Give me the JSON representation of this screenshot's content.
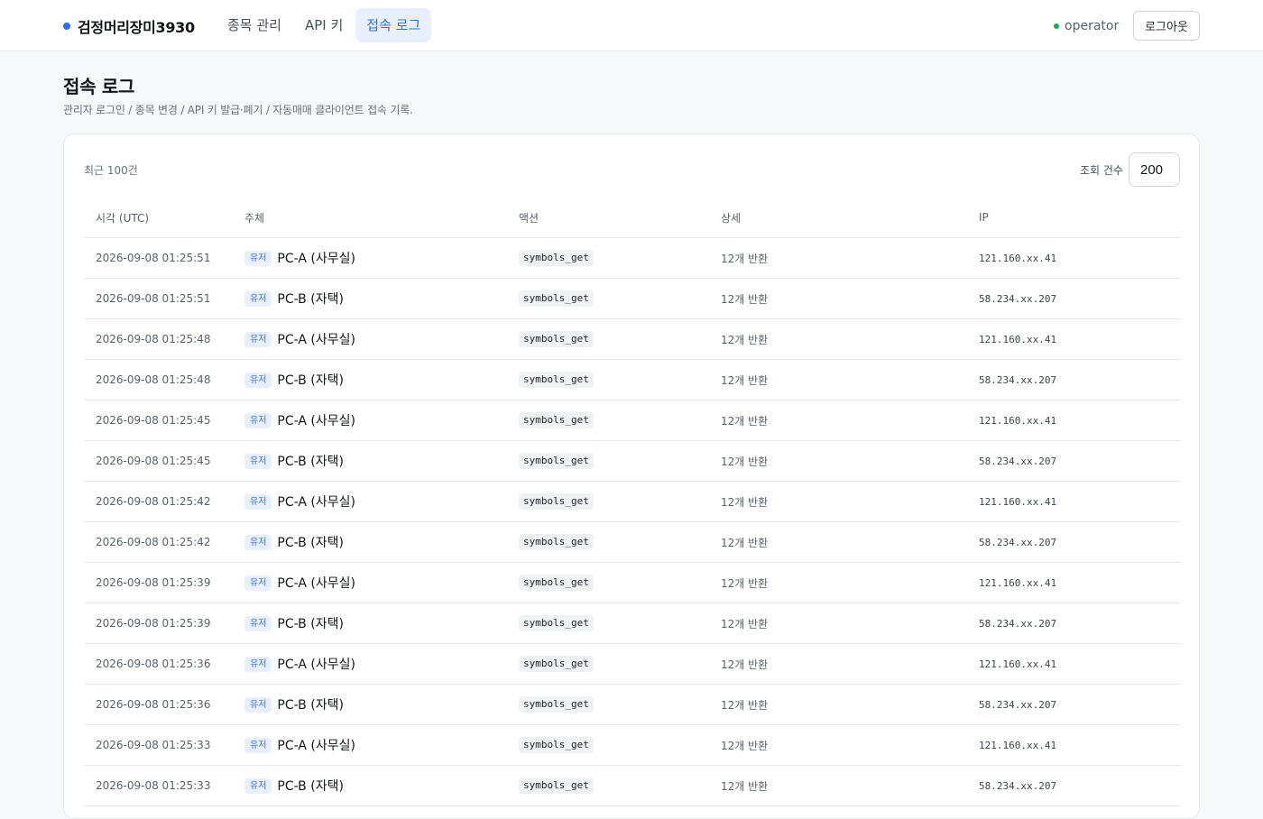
{
  "header": {
    "brand": "검정머리장미3930",
    "tabs": [
      {
        "label": "종목 관리",
        "active": false
      },
      {
        "label": "API 키",
        "active": false
      },
      {
        "label": "접속 로그",
        "active": true
      }
    ],
    "user": "operator",
    "logout_label": "로그아웃"
  },
  "page": {
    "title": "접속 로그",
    "subtitle": "관리자 로그인 / 종목 변경 / API 키 발급·폐기 / 자동매매 클라이언트 접속 기록."
  },
  "log_card": {
    "recent_label": "최근 100건",
    "limit_label": "조회 건수",
    "limit_value": "200",
    "columns": [
      "시각 (UTC)",
      "주체",
      "액션",
      "상세",
      "IP"
    ],
    "rows": [
      {
        "time": "2026-09-08 01:25:51",
        "badge": "유저",
        "subject": "PC-A (사무실)",
        "action": "symbols_get",
        "detail": "12개 반환",
        "ip": "121.160.xx.41"
      },
      {
        "time": "2026-09-08 01:25:51",
        "badge": "유저",
        "subject": "PC-B (자택)",
        "action": "symbols_get",
        "detail": "12개 반환",
        "ip": "58.234.xx.207"
      },
      {
        "time": "2026-09-08 01:25:48",
        "badge": "유저",
        "subject": "PC-A (사무실)",
        "action": "symbols_get",
        "detail": "12개 반환",
        "ip": "121.160.xx.41"
      },
      {
        "time": "2026-09-08 01:25:48",
        "badge": "유저",
        "subject": "PC-B (자택)",
        "action": "symbols_get",
        "detail": "12개 반환",
        "ip": "58.234.xx.207"
      },
      {
        "time": "2026-09-08 01:25:45",
        "badge": "유저",
        "subject": "PC-A (사무실)",
        "action": "symbols_get",
        "detail": "12개 반환",
        "ip": "121.160.xx.41"
      },
      {
        "time": "2026-09-08 01:25:45",
        "badge": "유저",
        "subject": "PC-B (자택)",
        "action": "symbols_get",
        "detail": "12개 반환",
        "ip": "58.234.xx.207"
      },
      {
        "time": "2026-09-08 01:25:42",
        "badge": "유저",
        "subject": "PC-A (사무실)",
        "action": "symbols_get",
        "detail": "12개 반환",
        "ip": "121.160.xx.41"
      },
      {
        "time": "2026-09-08 01:25:42",
        "badge": "유저",
        "subject": "PC-B (자택)",
        "action": "symbols_get",
        "detail": "12개 반환",
        "ip": "58.234.xx.207"
      },
      {
        "time": "2026-09-08 01:25:39",
        "badge": "유저",
        "subject": "PC-A (사무실)",
        "action": "symbols_get",
        "detail": "12개 반환",
        "ip": "121.160.xx.41"
      },
      {
        "time": "2026-09-08 01:25:39",
        "badge": "유저",
        "subject": "PC-B (자택)",
        "action": "symbols_get",
        "detail": "12개 반환",
        "ip": "58.234.xx.207"
      },
      {
        "time": "2026-09-08 01:25:36",
        "badge": "유저",
        "subject": "PC-A (사무실)",
        "action": "symbols_get",
        "detail": "12개 반환",
        "ip": "121.160.xx.41"
      },
      {
        "time": "2026-09-08 01:25:36",
        "badge": "유저",
        "subject": "PC-B (자택)",
        "action": "symbols_get",
        "detail": "12개 반환",
        "ip": "58.234.xx.207"
      },
      {
        "time": "2026-09-08 01:25:33",
        "badge": "유저",
        "subject": "PC-A (사무실)",
        "action": "symbols_get",
        "detail": "12개 반환",
        "ip": "121.160.xx.41"
      },
      {
        "time": "2026-09-08 01:25:33",
        "badge": "유저",
        "subject": "PC-B (자택)",
        "action": "symbols_get",
        "detail": "12개 반환",
        "ip": "58.234.xx.207"
      }
    ]
  },
  "colors": {
    "accent": "#2f6fe4",
    "accent_bg": "#e9f0fd",
    "status_online": "#1fa65a"
  }
}
